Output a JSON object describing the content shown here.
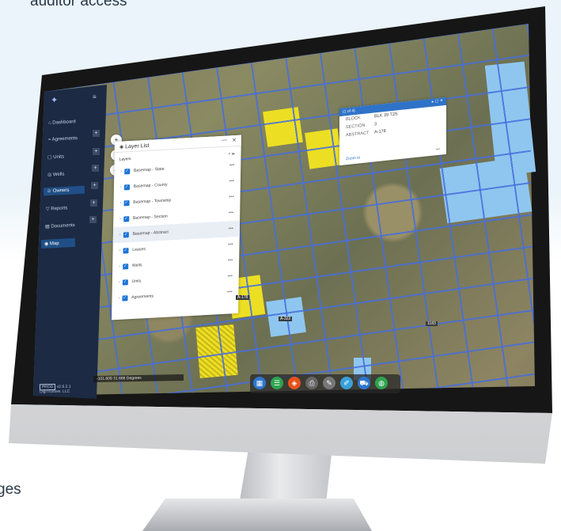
{
  "page": {
    "top_text": "auditor access",
    "side_text": "ges"
  },
  "sidebar": {
    "logo": "logo-icon",
    "items": [
      {
        "label": "Dashboard",
        "icon": "home-icon"
      },
      {
        "label": "Agreements",
        "icon": "handshake-icon"
      },
      {
        "label": "Units",
        "icon": "grid-icon"
      },
      {
        "label": "Wells",
        "icon": "well-icon"
      },
      {
        "label": "Owners",
        "icon": "people-icon",
        "active": true
      },
      {
        "label": "Reports",
        "icon": "filter-icon"
      },
      {
        "label": "Documents",
        "icon": "document-icon"
      },
      {
        "label": "Map",
        "icon": "map-pin-icon"
      }
    ],
    "version_badge": "PROD",
    "version": "v2.6.2.1",
    "company": "DigiTrustive, LLC"
  },
  "layer_panel": {
    "title": "Layer List",
    "legend": "Layers",
    "layers": [
      {
        "label": "Basemap - State",
        "checked": true
      },
      {
        "label": "Basemap - County",
        "checked": true
      },
      {
        "label": "Basemap - Township",
        "checked": true
      },
      {
        "label": "Basemap - Section",
        "checked": true
      },
      {
        "label": "Basemap - Abstract",
        "checked": true,
        "active": true
      },
      {
        "label": "Leases",
        "checked": true
      },
      {
        "label": "Wells",
        "checked": true
      },
      {
        "label": "Units",
        "checked": true
      },
      {
        "label": "Agreements",
        "checked": true
      }
    ]
  },
  "popup": {
    "header": "(1 of 4)",
    "rows": [
      {
        "key": "BLOCK",
        "value": "BLK 39 T2S"
      },
      {
        "key": "SECTION",
        "value": "3"
      },
      {
        "key": "ABSTRACT",
        "value": "A-178"
      }
    ],
    "link": "Zoom to"
  },
  "map": {
    "coords": "-101.809 31.688 Degrees",
    "labels": [
      "A-178",
      "A-322",
      "1183"
    ],
    "toolbar": [
      {
        "icon": "grid-icon",
        "color": "#2d77d0"
      },
      {
        "icon": "list-icon",
        "color": "#2ea44f"
      },
      {
        "icon": "layers-icon",
        "color": "#e5531c"
      },
      {
        "icon": "print-icon",
        "color": "#666666"
      },
      {
        "icon": "measure-icon",
        "color": "#777777"
      },
      {
        "icon": "draw-icon",
        "color": "#3aa0d8"
      },
      {
        "icon": "car-icon",
        "color": "#2d77d0"
      },
      {
        "icon": "globe-icon",
        "color": "#2ea44f"
      }
    ]
  }
}
